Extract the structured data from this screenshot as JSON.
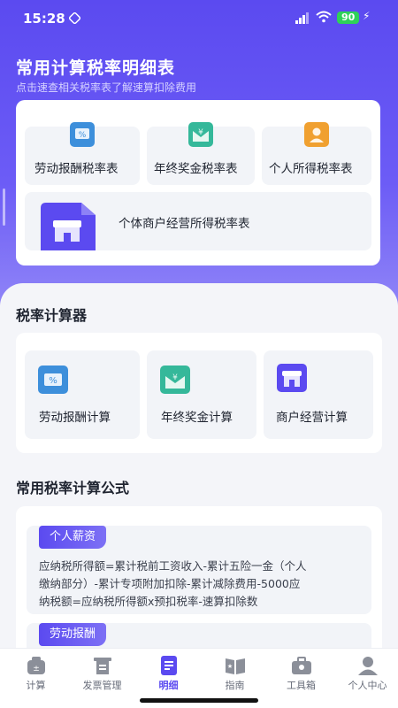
{
  "status_bar": {
    "time": "15:28",
    "battery": "90"
  },
  "header": {
    "title": "常用计算税率明细表",
    "subtitle": "点击速查相关税率表了解速算扣除费用"
  },
  "rate_tables": [
    {
      "label": "劳动报酬税率表",
      "icon": "receipt-percent-icon",
      "color": "#3d8fdb"
    },
    {
      "label": "年终奖金税率表",
      "icon": "yuan-envelope-icon",
      "color": "#35b89a"
    },
    {
      "label": "个人所得税率表",
      "icon": "person-badge-icon",
      "color": "#f0a030"
    },
    {
      "label": "个体商户经营所得税率表",
      "icon": "storefront-icon",
      "color": "#5b4af0"
    }
  ],
  "calculator": {
    "title": "税率计算器",
    "items": [
      {
        "label": "劳动报酬计算",
        "icon": "receipt-percent-icon"
      },
      {
        "label": "年终奖金计算",
        "icon": "yuan-envelope-icon"
      },
      {
        "label": "商户经营计算",
        "icon": "storefront-icon"
      }
    ]
  },
  "formulas": {
    "title": "常用税率计算公式",
    "items": [
      {
        "tag": "个人薪资",
        "lines": [
          "应纳税所得额=累计税前工资收入-累计五险一金（个人",
          "缴纳部分）-累计专项附加扣除-累计减除费用-5000应",
          "纳税额=应纳税所得额x预扣税率-速算扣除数"
        ]
      },
      {
        "tag": "劳动报酬"
      }
    ]
  },
  "tabbar": {
    "items": [
      {
        "label": "计算",
        "icon": "calculator-icon"
      },
      {
        "label": "发票管理",
        "icon": "invoice-icon"
      },
      {
        "label": "明细",
        "icon": "list-detail-icon",
        "active": true
      },
      {
        "label": "指南",
        "icon": "guide-book-icon"
      },
      {
        "label": "工具箱",
        "icon": "toolbox-icon"
      },
      {
        "label": "个人中心",
        "icon": "user-icon"
      }
    ]
  },
  "colors": {
    "brand": "#5b4af0",
    "blue": "#3d8fdb",
    "teal": "#35b89a",
    "orange": "#f0a030"
  }
}
